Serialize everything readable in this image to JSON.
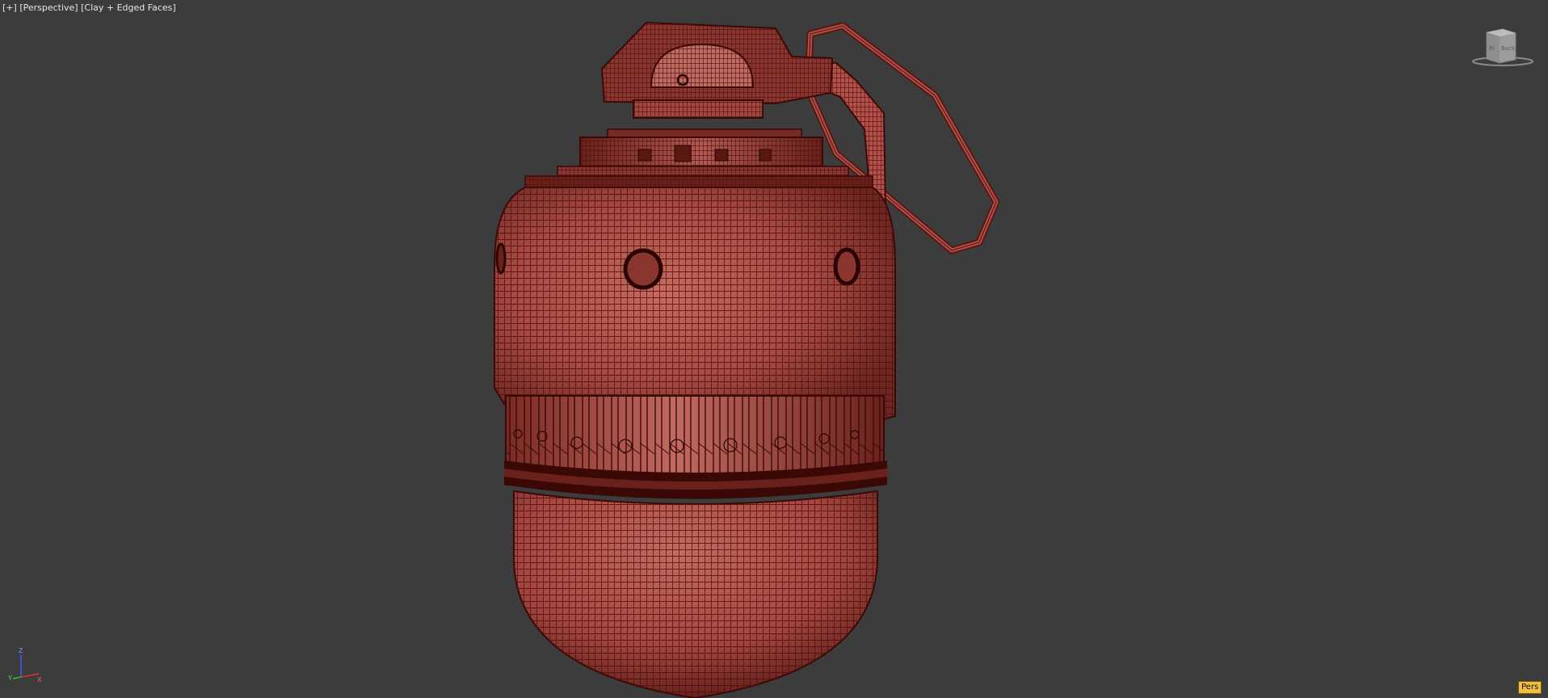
{
  "viewport": {
    "plus_label": "[+]",
    "view_label": "[Perspective]",
    "shading_label": "[Clay + Edged Faces]"
  },
  "viewcube": {
    "face_left": "Ri",
    "face_right": "Back"
  },
  "axis_gizmo": {
    "x": "X",
    "y": "Y",
    "z": "Z"
  },
  "badge": {
    "text": "Pers",
    "color": "#f0c040"
  },
  "colors": {
    "background": "#3c3c3c",
    "clay_base": "#b4504a",
    "wire": "#4a0f0c"
  },
  "icons": [
    "viewcube-icon",
    "axis-tripod-icon"
  ]
}
